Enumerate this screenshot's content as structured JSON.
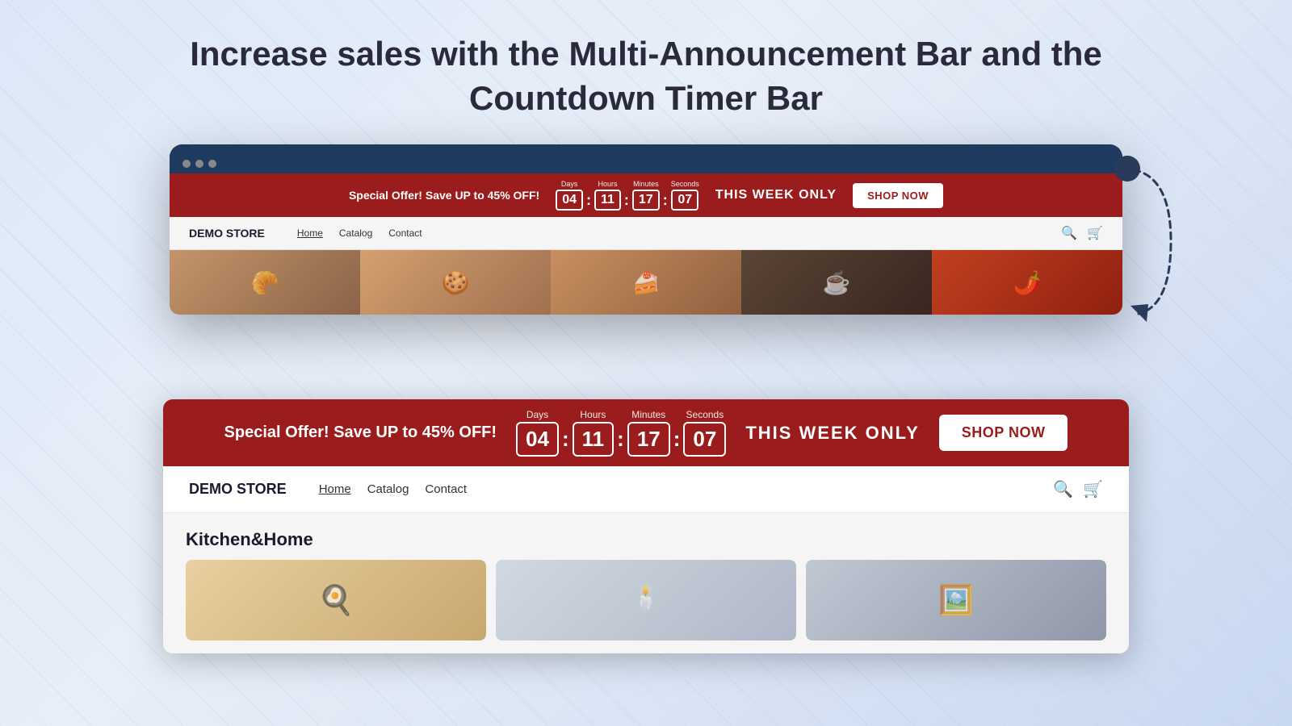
{
  "header": {
    "title_part1": "Increase sales",
    "title_part2": " with the Multi-Announcement Bar and the",
    "title_line2": "Countdown Timer Bar"
  },
  "browser": {
    "announcement": {
      "offer_text": "Special Offer! Save UP to 45% OFF!",
      "countdown": {
        "days_label": "Days",
        "days_value": "04",
        "hours_label": "Hours",
        "hours_value": "11",
        "minutes_label": "Minutes",
        "minutes_value": "17",
        "seconds_label": "Seconds",
        "seconds_value": "07",
        "separator": ":"
      },
      "week_text": "THIS WEEK ONLY",
      "shop_button": "SHOP NOW"
    },
    "nav": {
      "store_name": "DEMO STORE",
      "links": [
        "Home",
        "Catalog",
        "Contact"
      ],
      "active_link": "Home"
    }
  },
  "popup": {
    "announcement": {
      "offer_text": "Special Offer! Save UP to 45% OFF!",
      "countdown": {
        "days_label": "Days",
        "days_value": "04",
        "hours_label": "Hours",
        "hours_value": "11",
        "minutes_label": "Minutes",
        "minutes_value": "17",
        "seconds_label": "Seconds",
        "seconds_value": "07",
        "separator": ":"
      },
      "week_text": "THIS WEEK ONLY",
      "shop_button": "SHOP NOW"
    },
    "nav": {
      "store_name": "DEMO STORE",
      "links": [
        "Home",
        "Catalog",
        "Contact"
      ],
      "active_link": "Home"
    },
    "kitchen": {
      "title": "Kitchen&Home"
    }
  },
  "food_items": [
    "🥐",
    "🍪",
    "🍰",
    "☕",
    "🌶️"
  ]
}
